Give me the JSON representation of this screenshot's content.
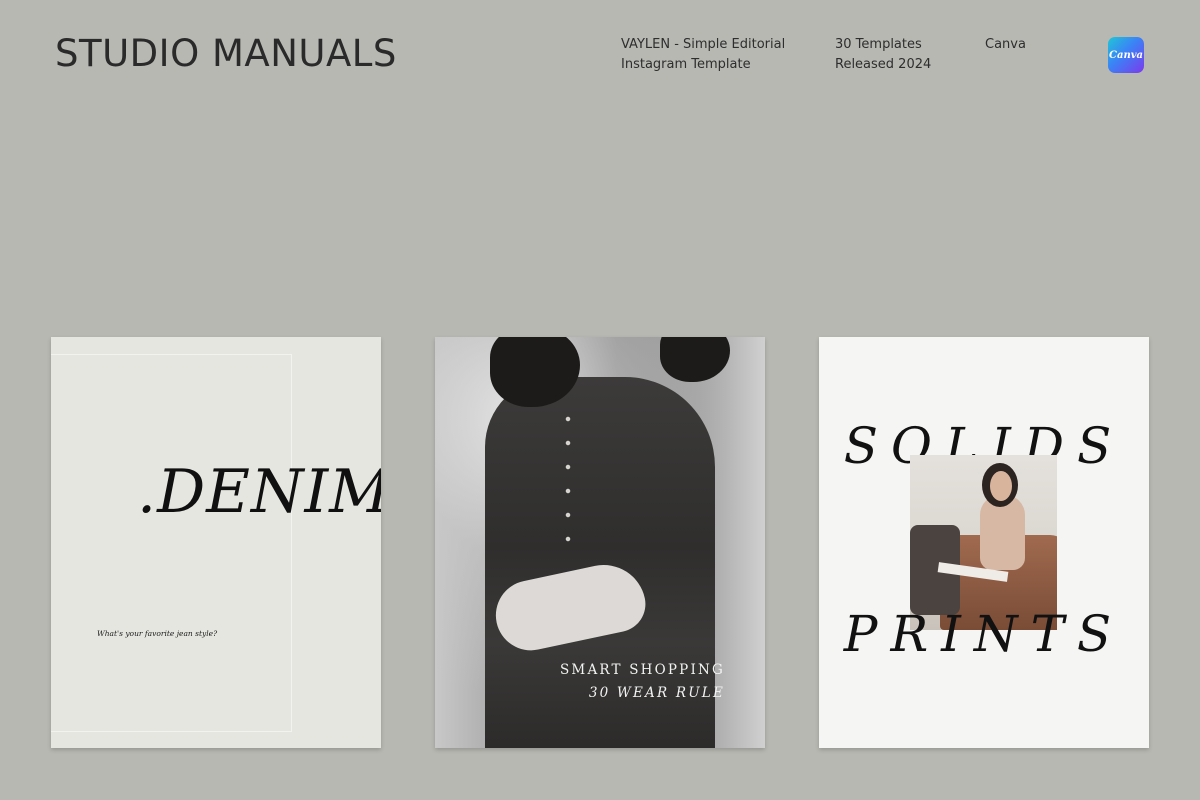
{
  "header": {
    "brand": "STUDIO MANUALS",
    "product_line1": "VAYLEN - Simple Editorial",
    "product_line2": "Instagram Template",
    "count_line1": "30 Templates",
    "count_line2": "Released 2024",
    "platform": "Canva",
    "badge_label": "Canva"
  },
  "cards": {
    "denim": {
      "title": ".DENIM",
      "question": "What's your favorite jean style?"
    },
    "photo": {
      "caption_line1": "SMART SHOPPING",
      "caption_line2": "30 WEAR RULE"
    },
    "solids": {
      "word_top": "SOLIDS",
      "word_bottom": "PRINTS"
    }
  },
  "colors": {
    "background": "#b7b8b2",
    "card_denim": "#e6e6e1",
    "card_solids": "#f5f5f3",
    "text_dark": "#2b2b2b"
  },
  "icons": {
    "badge": "canva-logo-icon"
  }
}
